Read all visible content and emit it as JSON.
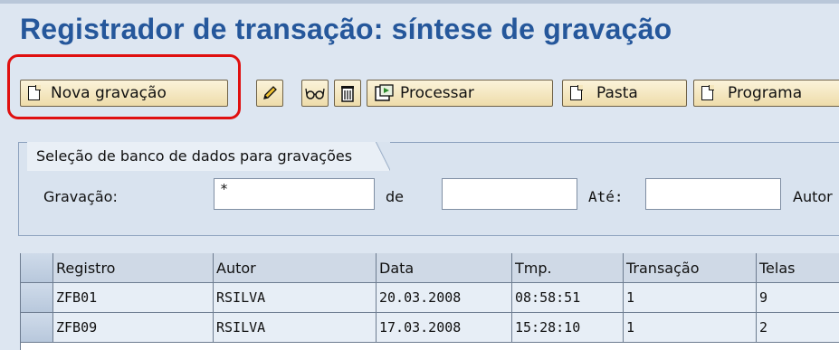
{
  "page": {
    "title": "Registrador de transação: síntese de gravação"
  },
  "toolbar": {
    "new_recording_label": "Nova gravação",
    "edit_icon": "pencil-icon",
    "display_icon": "glasses-icon",
    "delete_icon": "trash-icon",
    "process_icon": "process-icon",
    "process_label": "Processar",
    "folder_label": "Pasta",
    "program_label": "Programa"
  },
  "selection": {
    "tab_title": "Seleção de banco de dados para gravações",
    "recording_label": "Gravação:",
    "recording_value": "*",
    "from_label": "de",
    "from_value": "",
    "to_label": "Até:",
    "to_value": "",
    "author_label": "Autor"
  },
  "table": {
    "columns": [
      "Registro",
      "Autor",
      "Data",
      "Tmp.",
      "Transação",
      "Telas"
    ],
    "rows": [
      [
        "ZFB01",
        "RSILVA",
        "20.03.2008",
        "08:58:51",
        "1",
        "9"
      ],
      [
        "ZFB09",
        "RSILVA",
        "17.03.2008",
        "15:28:10",
        "1",
        "2"
      ]
    ]
  },
  "colors": {
    "title": "#25579b",
    "highlight": "#e01010",
    "button_bg": "#f3e4b8",
    "background": "#dde6f1"
  }
}
